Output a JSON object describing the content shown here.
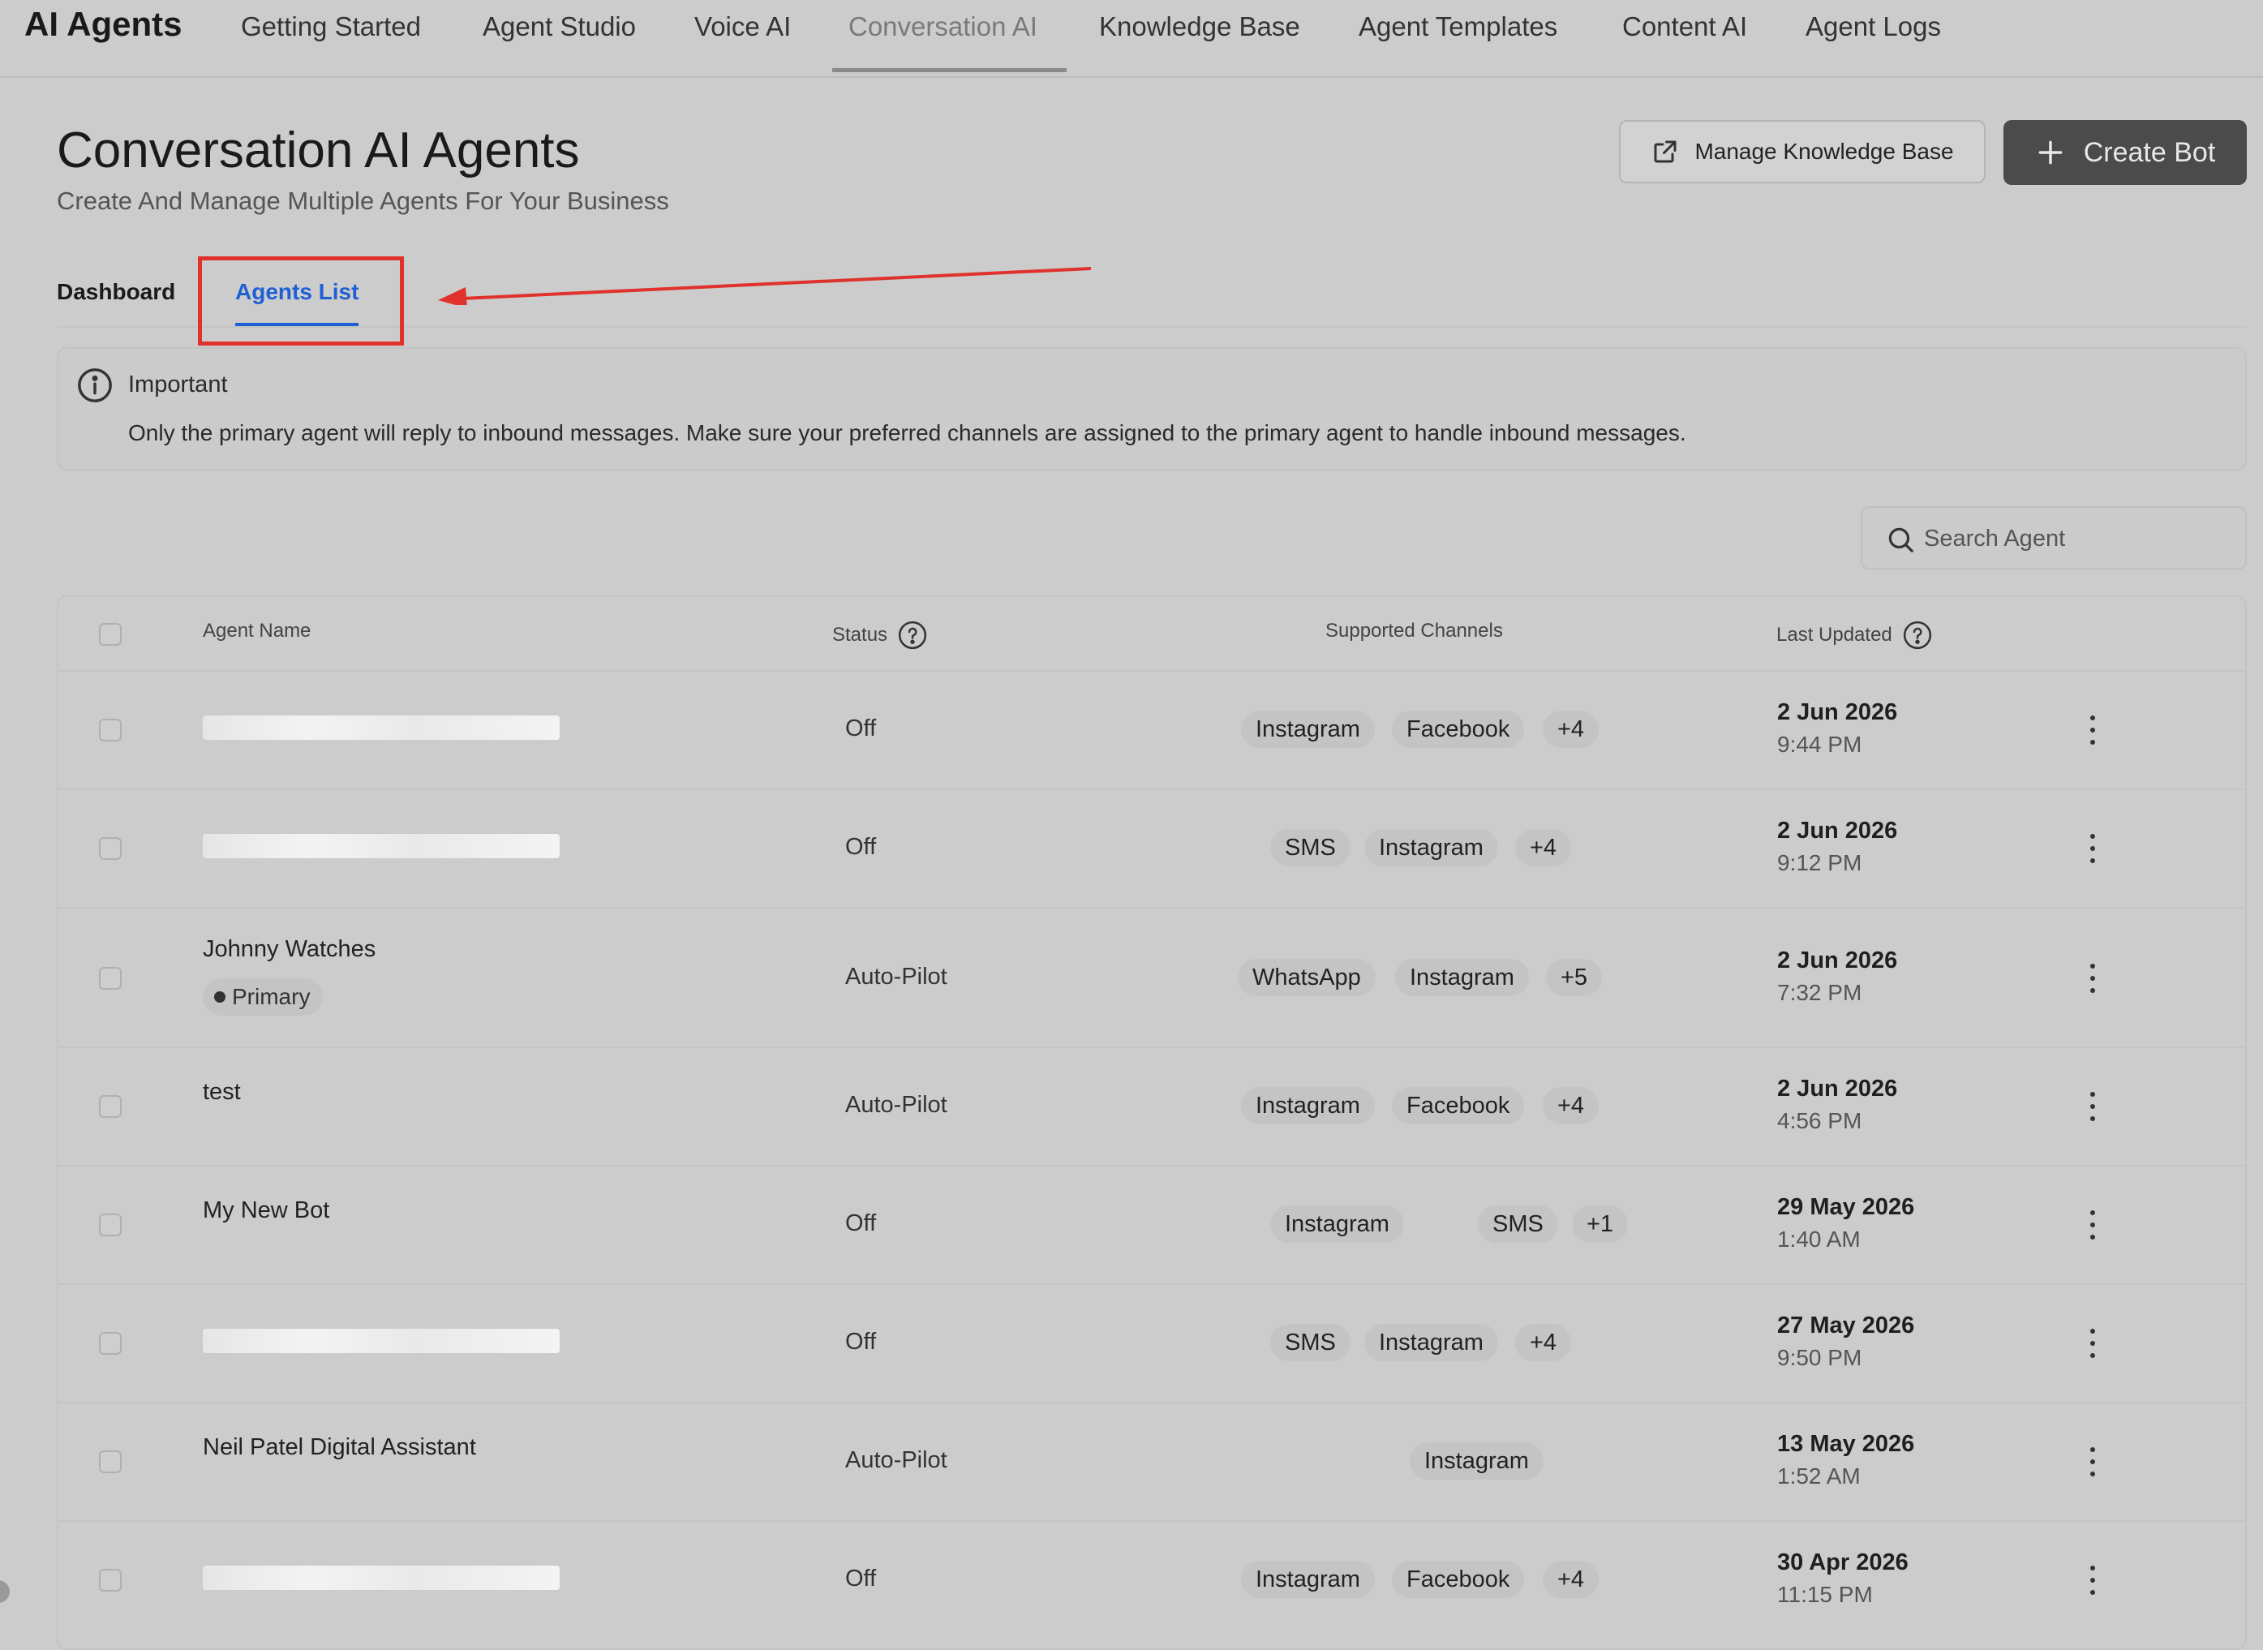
{
  "nav": {
    "brand": "AI Agents",
    "tabs": [
      "Getting Started",
      "Agent Studio",
      "Voice AI",
      "Conversation AI",
      "Knowledge Base",
      "Agent Templates",
      "Content AI",
      "Agent Logs"
    ],
    "active_tab": "Conversation AI"
  },
  "header": {
    "title": "Conversation AI Agents",
    "subtitle": "Create And Manage Multiple Agents For Your Business",
    "manage_kb_label": "Manage Knowledge Base",
    "create_bot_label": "Create Bot"
  },
  "subtabs": {
    "dashboard": "Dashboard",
    "agents_list": "Agents List",
    "active": "Agents List"
  },
  "info": {
    "title": "Important",
    "text": "Only the primary agent will reply to inbound messages. Make sure your preferred channels are assigned to the primary agent to handle inbound messages."
  },
  "search": {
    "placeholder": "Search Agent"
  },
  "table": {
    "headers": {
      "name": "Agent Name",
      "status": "Status",
      "channels": "Supported Channels",
      "updated": "Last Updated"
    },
    "rows": [
      {
        "name": "",
        "redacted": true,
        "primary": false,
        "status": "Off",
        "channels": [
          "Instagram",
          "Facebook"
        ],
        "more": "+4",
        "date": "2 Jun 2026",
        "time": "9:44 PM"
      },
      {
        "name": "",
        "redacted": true,
        "primary": false,
        "status": "Off",
        "channels": [
          "SMS",
          "Instagram"
        ],
        "more": "+4",
        "date": "2 Jun 2026",
        "time": "9:12 PM"
      },
      {
        "name": "Johnny Watches",
        "redacted": false,
        "primary": true,
        "primary_label": "Primary",
        "status": "Auto-Pilot",
        "channels": [
          "WhatsApp",
          "Instagram"
        ],
        "more": "+5",
        "date": "2 Jun 2026",
        "time": "7:32 PM"
      },
      {
        "name": "test",
        "redacted": false,
        "primary": false,
        "status": "Auto-Pilot",
        "channels": [
          "Instagram",
          "Facebook"
        ],
        "more": "+4",
        "date": "2 Jun 2026",
        "time": "4:56 PM"
      },
      {
        "name": "My New Bot",
        "redacted": false,
        "primary": false,
        "status": "Off",
        "channels": [
          "Instagram",
          "SMS"
        ],
        "more": "+1",
        "date": "29 May 2026",
        "time": "1:40 AM"
      },
      {
        "name": "",
        "redacted": true,
        "primary": false,
        "status": "Off",
        "channels": [
          "SMS",
          "Instagram"
        ],
        "more": "+4",
        "date": "27 May 2026",
        "time": "9:50 PM"
      },
      {
        "name": "Neil Patel Digital Assistant",
        "redacted": false,
        "primary": false,
        "status": "Auto-Pilot",
        "channels": [
          "Instagram"
        ],
        "more": "",
        "date": "13 May 2026",
        "time": "1:52 AM"
      },
      {
        "name": "",
        "redacted": true,
        "primary": false,
        "status": "Off",
        "channels": [
          "Instagram",
          "Facebook"
        ],
        "more": "+4",
        "date": "30 Apr 2026",
        "time": "11:15 PM"
      }
    ]
  },
  "colors": {
    "accent": "#1f5fd6",
    "highlight": "#e0322d",
    "create_button": "#4b4b4b"
  },
  "icons": {
    "info": "info-circle-icon",
    "help": "question-circle-icon",
    "search": "search-icon",
    "external": "external-link-icon",
    "plus": "plus-icon",
    "menu": "kebab-menu-icon"
  }
}
